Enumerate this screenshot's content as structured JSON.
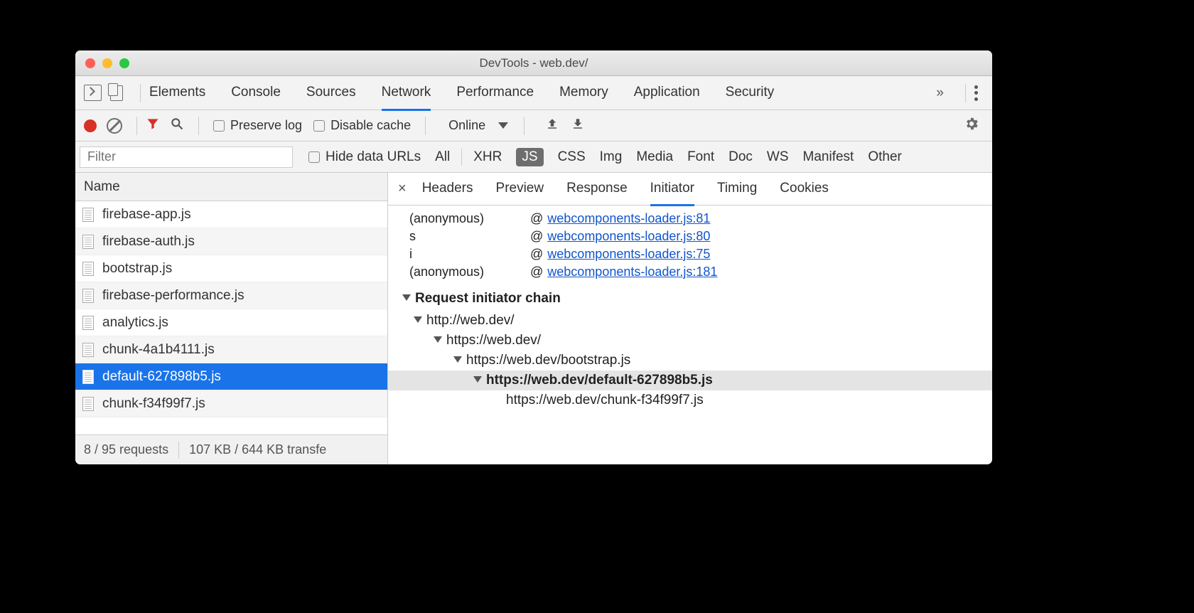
{
  "window": {
    "title": "DevTools - web.dev/"
  },
  "mainTabs": {
    "items": [
      "Elements",
      "Console",
      "Sources",
      "Network",
      "Performance",
      "Memory",
      "Application",
      "Security"
    ],
    "active": "Network",
    "expand": "»"
  },
  "toolbar": {
    "preserve": "Preserve log",
    "disable": "Disable cache",
    "throttle": "Online"
  },
  "filterbar": {
    "placeholder": "Filter",
    "hide": "Hide data URLs",
    "types": [
      "All",
      "XHR",
      "JS",
      "CSS",
      "Img",
      "Media",
      "Font",
      "Doc",
      "WS",
      "Manifest",
      "Other"
    ],
    "active": "JS"
  },
  "list": {
    "header": "Name",
    "items": [
      {
        "name": "firebase-app.js"
      },
      {
        "name": "firebase-auth.js"
      },
      {
        "name": "bootstrap.js"
      },
      {
        "name": "firebase-performance.js"
      },
      {
        "name": "analytics.js"
      },
      {
        "name": "chunk-4a1b4111.js"
      },
      {
        "name": "default-627898b5.js",
        "selected": true
      },
      {
        "name": "chunk-f34f99f7.js"
      }
    ],
    "status": {
      "requests": "8 / 95 requests",
      "transfer": "107 KB / 644 KB transfe"
    }
  },
  "detailTabs": {
    "items": [
      "Headers",
      "Preview",
      "Response",
      "Initiator",
      "Timing",
      "Cookies"
    ],
    "active": "Initiator"
  },
  "callstack": [
    {
      "fn": "(anonymous)",
      "at": "@",
      "link": "webcomponents-loader.js:81"
    },
    {
      "fn": "s",
      "at": "@",
      "link": "webcomponents-loader.js:80"
    },
    {
      "fn": "i",
      "at": "@",
      "link": "webcomponents-loader.js:75"
    },
    {
      "fn": "(anonymous)",
      "at": "@",
      "link": "webcomponents-loader.js:181"
    }
  ],
  "chain": {
    "title": "Request initiator chain",
    "rows": [
      {
        "depth": 0,
        "text": "http://web.dev/",
        "tri": true
      },
      {
        "depth": 1,
        "text": "https://web.dev/",
        "tri": true
      },
      {
        "depth": 2,
        "text": "https://web.dev/bootstrap.js",
        "tri": true
      },
      {
        "depth": 3,
        "text": "https://web.dev/default-627898b5.js",
        "tri": true,
        "hl": true
      },
      {
        "depth": 4,
        "text": "https://web.dev/chunk-f34f99f7.js",
        "tri": false
      }
    ]
  }
}
